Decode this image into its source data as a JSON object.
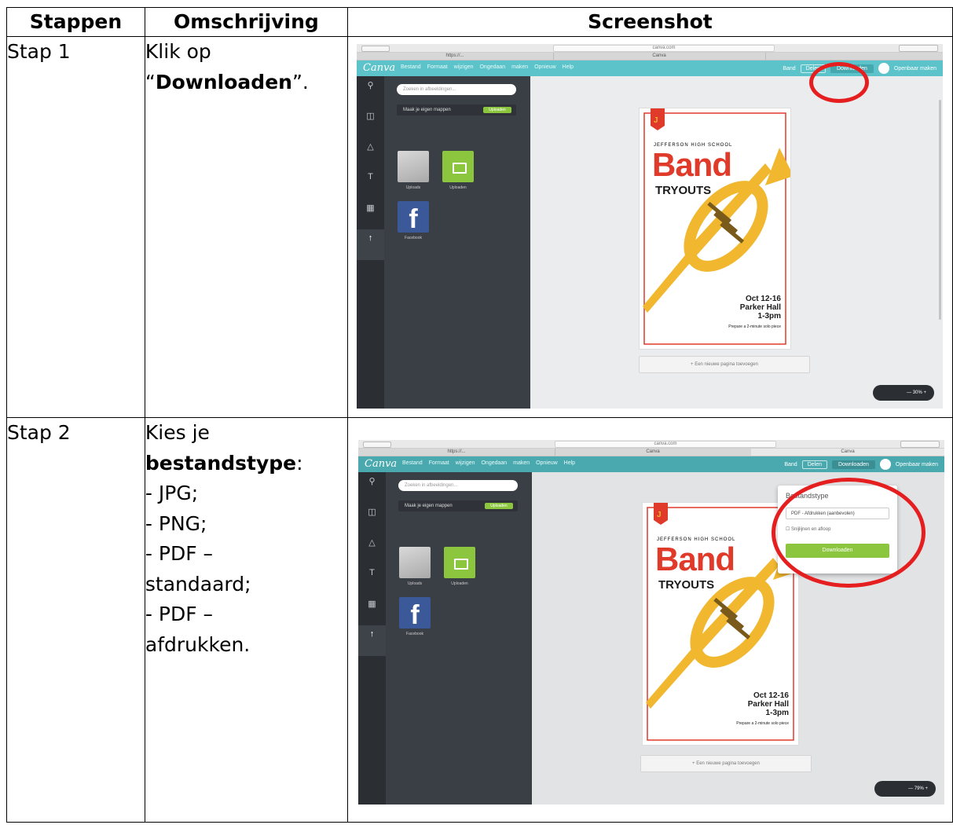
{
  "headers": {
    "steps": "Stappen",
    "description": "Omschrijving",
    "screenshot": "Screenshot"
  },
  "rows": [
    {
      "step": "Stap 1",
      "desc_line1": "Klik op",
      "desc_q_open": "“",
      "desc_bold": "Downloaden",
      "desc_q_close": "”."
    },
    {
      "step": "Stap 2",
      "desc_line1": "Kies je",
      "desc_bold": "bestandstype",
      "desc_colon": ":",
      "desc_items": [
        "- JPG;",
        "- PNG;",
        "- PDF –",
        "standaard;",
        "- PDF –",
        "afdrukken."
      ]
    }
  ],
  "canva": {
    "url": "canva.com",
    "tab1": "https://...",
    "tab2": "Canva",
    "logo": "Canva",
    "menu": "Bestand Formaat wijzigen Ongedaan maken Opnieuw Help",
    "band_label": "Band",
    "share_label": "Delen",
    "download_label": "Downloaden",
    "publish_label": "Openbaar maken",
    "search_placeholder": "Zoeken in afbeeldingen...",
    "folder_label": "Maak je eigen mappen",
    "upload_label": "Uploaden",
    "icon_uploads": "Uploads",
    "icon_other": "Uploaden",
    "icon_facebook": "Facebook",
    "new_page": "+ Een nieuwe pagina toevoegen",
    "zoom1": "— 30% +",
    "zoom2": "— 79% +",
    "dl_type_title": "Bestandstype",
    "dl_select": "PDF - Afdrukken (aanbevolen)",
    "dl_check": "Snijlijnen en afloop",
    "dl_button": "Downloaden"
  },
  "poster": {
    "school": "JEFFERSON HIGH SCHOOL",
    "band": "Band",
    "tryouts": "TRYOUTS",
    "date": "Oct 12-16",
    "place": "Parker Hall",
    "time": "1-3pm",
    "note": "Prepare a 2-minute solo piece",
    "colors": {
      "red": "#e03a2a",
      "gold": "#f0b72f",
      "dark": "#1b1b1b",
      "teal": "#5bc3c9"
    }
  }
}
